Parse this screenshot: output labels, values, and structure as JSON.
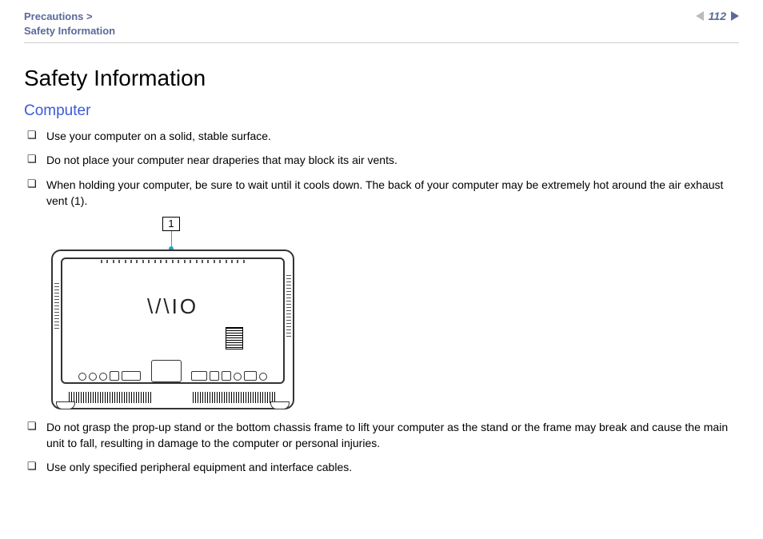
{
  "breadcrumb": {
    "parent": "Precautions >",
    "current": "Safety Information"
  },
  "page_number": "112",
  "title": "Safety Information",
  "subheading": "Computer",
  "callout_label": "1",
  "device_logo": "\\/\\IO",
  "bullets_top": [
    "Use your computer on a solid, stable surface.",
    "Do not place your computer near draperies that may block its air vents.",
    "When holding your computer, be sure to wait until it cools down. The back of your computer may be extremely hot around the air exhaust vent (1)."
  ],
  "bullets_bottom": [
    "Do not grasp the prop-up stand or the bottom chassis frame to lift your computer as the stand or the frame may break and cause the main unit to fall, resulting in damage to the computer or personal injuries.",
    "Use only specified peripheral equipment and interface cables."
  ]
}
